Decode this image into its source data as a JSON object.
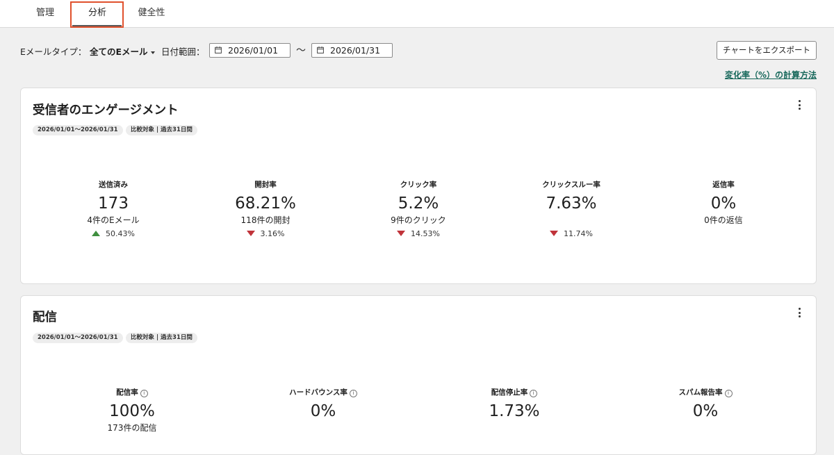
{
  "tabs": {
    "manage": "管理",
    "analysis": "分析",
    "health": "健全性"
  },
  "filters": {
    "email_type_label": "Eメールタイプ：",
    "email_type_value": "全てのEメール",
    "date_range_label": "日付範囲：",
    "start_date": "2026/01/01",
    "end_date": "2026/01/31",
    "separator": "〜"
  },
  "actions": {
    "export_label": "チャートをエクスポート",
    "help_link": "変化率（%）の計算方法"
  },
  "engagement": {
    "title": "受信者のエンゲージメント",
    "date_chip": "2026/01/01～2026/01/31",
    "compare_chip": "比較対象 | 過去31日間",
    "metrics": [
      {
        "label": "送信済み",
        "value": "173",
        "sub": "4件のEメール",
        "change": "50.43%",
        "direction": "up"
      },
      {
        "label": "開封率",
        "value": "68.21%",
        "sub": "118件の開封",
        "change": "3.16%",
        "direction": "down"
      },
      {
        "label": "クリック率",
        "value": "5.2%",
        "sub": "9件のクリック",
        "change": "14.53%",
        "direction": "down"
      },
      {
        "label": "クリックスルー率",
        "value": "7.63%",
        "sub": "",
        "change": "11.74%",
        "direction": "down"
      },
      {
        "label": "返信率",
        "value": "0%",
        "sub": "0件の返信",
        "change": "",
        "direction": ""
      }
    ]
  },
  "delivery": {
    "title": "配信",
    "date_chip": "2026/01/01～2026/01/31",
    "compare_chip": "比較対象 | 過去31日間",
    "metrics": [
      {
        "label": "配信率",
        "value": "100%",
        "sub": "173件の配信"
      },
      {
        "label": "ハードバウンス率",
        "value": "0%",
        "sub": ""
      },
      {
        "label": "配信停止率",
        "value": "1.73%",
        "sub": ""
      },
      {
        "label": "スパム報告率",
        "value": "0%",
        "sub": ""
      }
    ]
  },
  "colors": {
    "highlight": "#e0502c",
    "link": "#17685b",
    "up": "#3f8f3f",
    "down": "#c0333a"
  },
  "icons": {
    "calendar": "calendar-icon",
    "info": "info-icon",
    "kebab": "more-vertical-icon",
    "caret": "chevron-down-icon"
  }
}
